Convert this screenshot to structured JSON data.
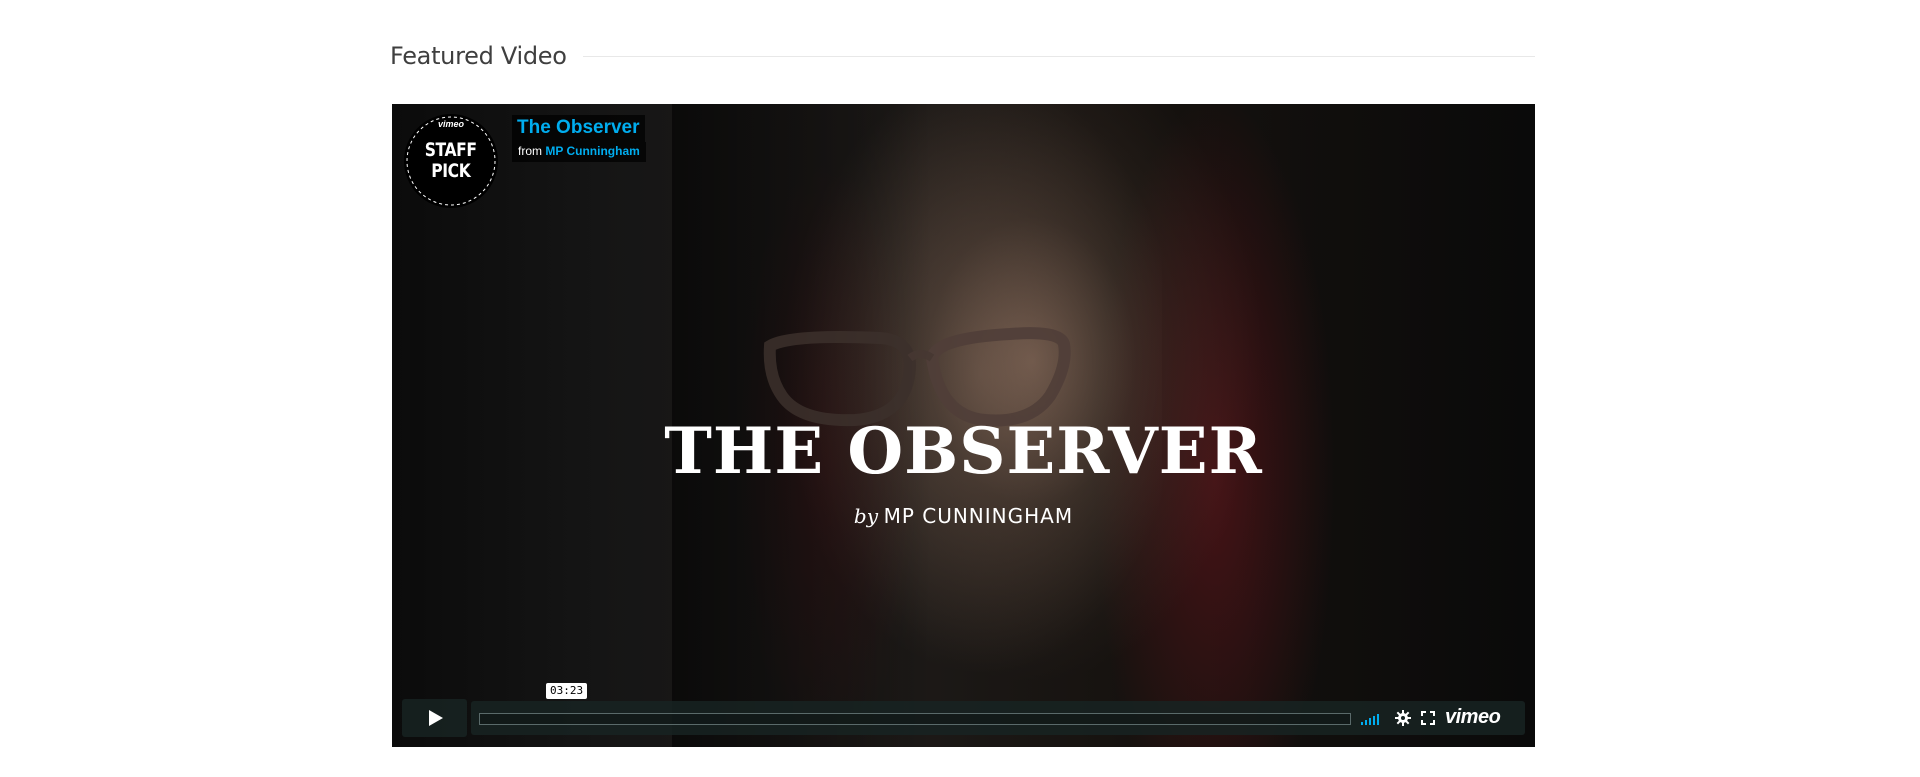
{
  "section": {
    "title": "Featured Video"
  },
  "player": {
    "badge": {
      "brand": "vimeo",
      "line1": "STAFF",
      "line2": "PICK"
    },
    "video_title": "The Observer",
    "byline": {
      "prefix": "from",
      "author": "MP Cunningham"
    },
    "overlay": {
      "title": "THE OBSERVER",
      "by": "by",
      "name": "MP CUNNINGHAM"
    },
    "controls": {
      "duration": "03:23",
      "progress": 0.0,
      "volume_level": 1.0,
      "logo": "vimeo",
      "icons": [
        "play-icon",
        "volume-icon",
        "gear-icon",
        "fullscreen-icon"
      ]
    },
    "colors": {
      "accent": "#00adef",
      "control_bg": "#172322"
    }
  }
}
